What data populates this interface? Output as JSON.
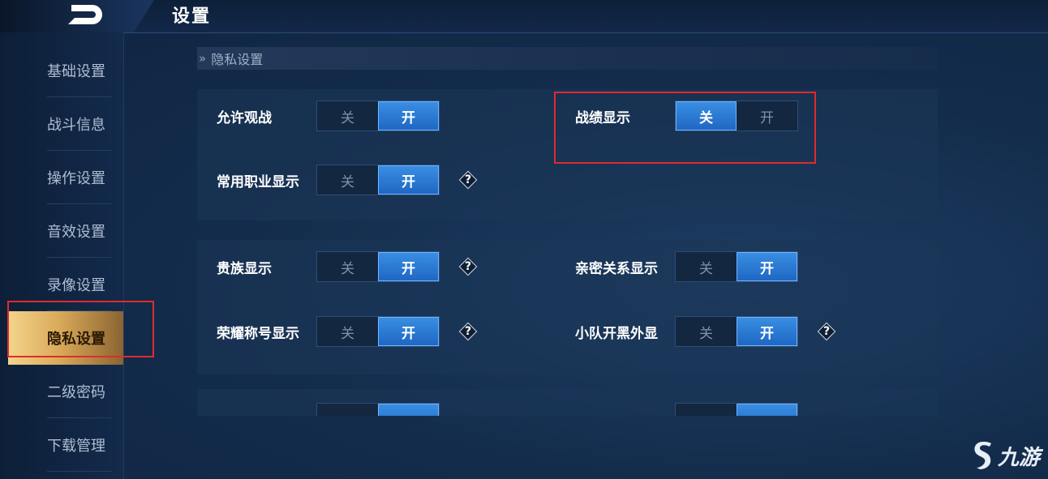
{
  "header": {
    "title": "设置"
  },
  "sidebar": {
    "items": [
      {
        "label": "基础设置"
      },
      {
        "label": "战斗信息"
      },
      {
        "label": "操作设置"
      },
      {
        "label": "音效设置"
      },
      {
        "label": "录像设置"
      },
      {
        "label": "隐私设置",
        "active": true
      },
      {
        "label": "二级密码"
      },
      {
        "label": "下载管理"
      }
    ]
  },
  "section": {
    "title": "隐私设置"
  },
  "toggle_labels": {
    "off": "关",
    "on": "开"
  },
  "settings": [
    {
      "label": "允许观战",
      "value": "开",
      "help": false
    },
    {
      "label": "战绩显示",
      "value": "关",
      "help": false
    },
    {
      "label": "常用职业显示",
      "value": "开",
      "help": true
    },
    {
      "label": "贵族显示",
      "value": "开",
      "help": true
    },
    {
      "label": "亲密关系显示",
      "value": "开",
      "help": false
    },
    {
      "label": "荣耀称号显示",
      "value": "开",
      "help": true
    },
    {
      "label": "小队开黑外显",
      "value": "开",
      "help": true
    }
  ],
  "help_glyph": "?",
  "watermark": {
    "text": "九游"
  },
  "colors": {
    "accent": "#2a78d6",
    "active_tab": "#d9a959",
    "highlight_box": "#e02b2b"
  }
}
